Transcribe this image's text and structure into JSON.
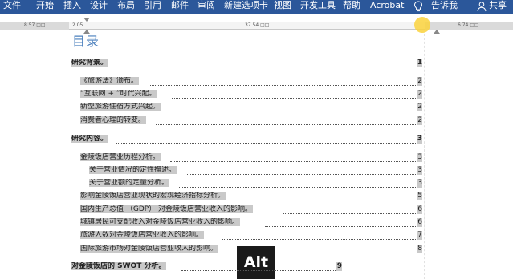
{
  "ribbon": {
    "tabs": [
      {
        "label": "文件"
      },
      {
        "label": "开始"
      },
      {
        "label": "插入"
      },
      {
        "label": "设计"
      },
      {
        "label": "布局"
      },
      {
        "label": "引用"
      },
      {
        "label": "邮件"
      },
      {
        "label": "审阅"
      },
      {
        "label": "新建选项卡"
      },
      {
        "label": "视图"
      },
      {
        "label": "开发工具"
      },
      {
        "label": "帮助"
      },
      {
        "label": "Acrobat"
      }
    ],
    "tell_me": "告诉我",
    "share": "共享",
    "bg_color": "#2b579a"
  },
  "ruler": {
    "left_margin_label": "8.57 □□",
    "indent_label": "2.05",
    "text_width_label": "37.54 □□",
    "right_margin_label": "6.74 □□"
  },
  "document": {
    "toc_title": "目录",
    "toc_entries": [
      {
        "text": "研究背景。",
        "page": "1",
        "level": 1
      },
      {
        "text": "《旅游法》颁布。",
        "page": "2",
        "level": 2
      },
      {
        "text": "“互联网 + ”时代兴起。",
        "page": "2",
        "level": 2
      },
      {
        "text": "新型旅游住宿方式兴起。",
        "page": "2",
        "level": 2
      },
      {
        "text": "消费者心理的转变。",
        "page": "2",
        "level": 2
      },
      {
        "text": "研究内容。",
        "page": "3",
        "level": 1
      },
      {
        "text": "金陵饭店营业历程分析。",
        "page": "3",
        "level": 2
      },
      {
        "text": "关于营业情况的定性描述。",
        "page": "3",
        "level": 3
      },
      {
        "text": "关于营业额的定量分析。",
        "page": "3",
        "level": 3
      },
      {
        "text": "影响金陵饭店营业现状的宏观经济指标分析。",
        "page": "5",
        "level": 2
      },
      {
        "text": "国内生产总值 （GDP） 对金陵饭店营业收入的影响。",
        "page": "6",
        "level": 2
      },
      {
        "text": "城镇居民可支配收入对金陵饭店营业收入的影响。",
        "page": "6",
        "level": 2
      },
      {
        "text": "旅游人数对金陵饭店营业收入的影响。",
        "page": "7",
        "level": 2
      },
      {
        "text": "国际旅游市场对金陵饭店营业收入的影响。",
        "page": "8",
        "level": 2
      },
      {
        "text": "对金陵饭店的 SWOT 分析。",
        "page": "9",
        "level": 1
      }
    ],
    "title_color": "#4a7fbd",
    "highlight_color": "#c9c9c9"
  },
  "keystroke_overlay": {
    "label": "Alt"
  }
}
